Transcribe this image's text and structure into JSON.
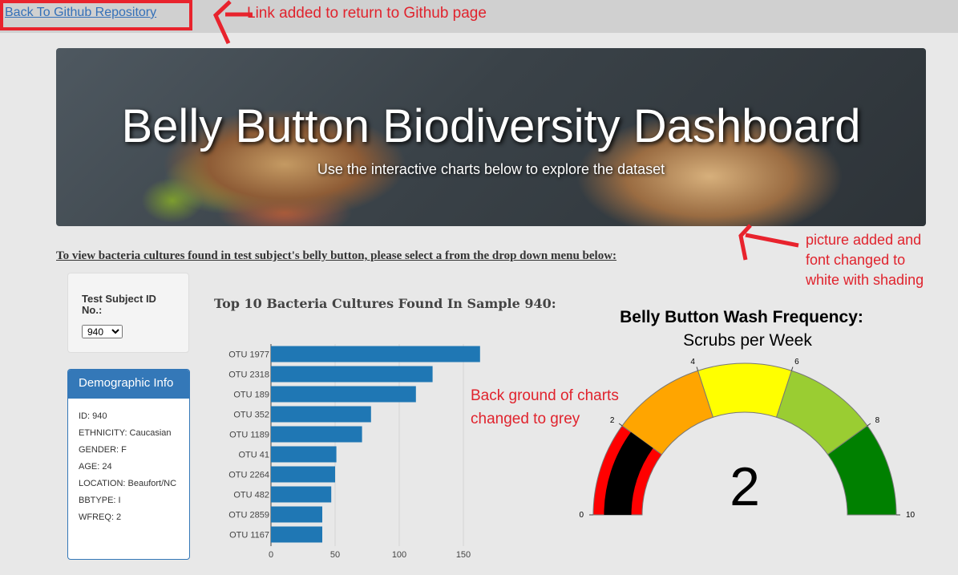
{
  "link": {
    "back_label": "Back To Github Repository"
  },
  "annotations": {
    "link_note": "Link added to return to Github page",
    "picture_note": [
      "picture added and",
      "font changed to",
      "white with shading"
    ],
    "background_note": [
      "Back ground of charts",
      "changed to grey"
    ],
    "color": "#e0232d"
  },
  "hero": {
    "title": "Belly Button Biodiversity Dashboard",
    "subtitle": "Use the interactive charts below to explore the dataset"
  },
  "instruction": "To view bacteria cultures found in test subject's belly button, please select a from the drop down menu below:",
  "selector": {
    "label": "Test Subject ID No.:",
    "selected": "940"
  },
  "demographics": {
    "title": "Demographic Info",
    "items": [
      "ID: 940",
      "ETHNICITY: Caucasian",
      "GENDER: F",
      "AGE: 24",
      "LOCATION: Beaufort/NC",
      "BBTYPE: I",
      "WFREQ: 2"
    ],
    "accent": "#3478b8"
  },
  "bar_title": "Top 10 Bacteria Cultures Found In Sample 940:",
  "gauge": {
    "title": "Belly Button Wash Frequency:",
    "subtitle": "Scrubs per Week"
  },
  "chart_data": [
    {
      "type": "bar",
      "orientation": "horizontal",
      "title": "Top 10 Bacteria Cultures Found In Sample 940:",
      "categories": [
        "OTU 1977",
        "OTU 2318",
        "OTU 189",
        "OTU 352",
        "OTU 1189",
        "OTU 41",
        "OTU 2264",
        "OTU 482",
        "OTU 2859",
        "OTU 1167"
      ],
      "values": [
        163,
        126,
        113,
        78,
        71,
        51,
        50,
        47,
        40,
        40
      ],
      "xlim": [
        0,
        170
      ],
      "xticks": [
        0,
        50,
        100,
        150
      ],
      "grid": true,
      "color": "#1f77b4"
    },
    {
      "type": "gauge",
      "title": "Belly Button Wash Frequency:",
      "subtitle": "Scrubs per Week",
      "value": 2,
      "range": [
        0,
        10
      ],
      "ticks": [
        0,
        2,
        4,
        6,
        8,
        10
      ],
      "bands": [
        {
          "from": 0,
          "to": 2,
          "color": "#ff0000"
        },
        {
          "from": 2,
          "to": 4,
          "color": "#ffa500"
        },
        {
          "from": 4,
          "to": 6,
          "color": "#ffff00"
        },
        {
          "from": 6,
          "to": 8,
          "color": "#9acd32"
        },
        {
          "from": 8,
          "to": 10,
          "color": "#008000"
        }
      ],
      "bar_color": "#000000"
    }
  ]
}
